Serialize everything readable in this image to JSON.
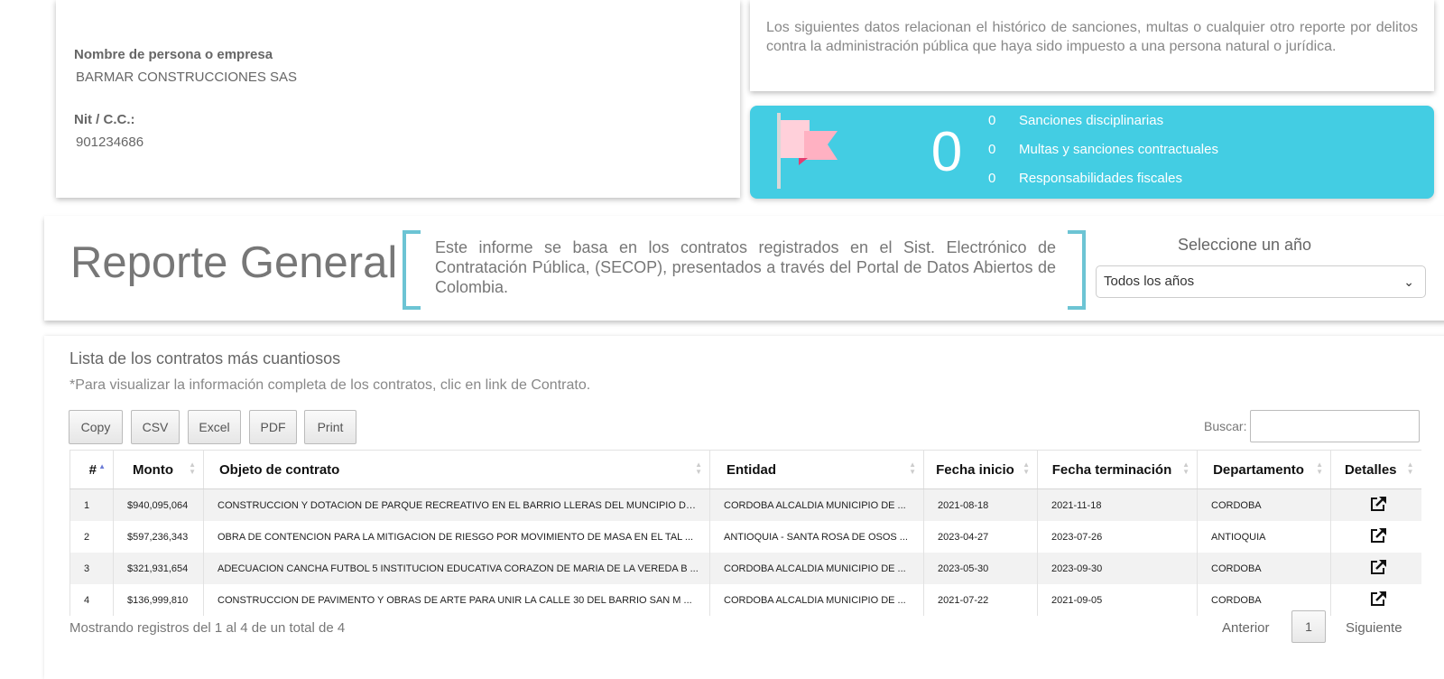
{
  "company": {
    "name_label": "Nombre de persona o empresa",
    "name_value": "BARMAR CONSTRUCCIONES SAS",
    "nit_label": "Nit / C.C.:",
    "nit_value": "901234686"
  },
  "sanctions_description": "Los siguientes datos relacionan el histórico de sanciones, multas o cualquier otro reporte por delitos contra la administración pública que haya sido impuesto a una persona natural o jurídica.",
  "sanctions": {
    "total": "0",
    "flag_icon": "flag-icon",
    "items": [
      {
        "count": "0",
        "label": "Sanciones disciplinarias"
      },
      {
        "count": "0",
        "label": "Multas y sanciones contractuales"
      },
      {
        "count": "0",
        "label": "Responsabilidades fiscales"
      }
    ],
    "background_color": "#43cde3"
  },
  "report": {
    "title": "Reporte General",
    "description": "Este informe se basa en los contratos registrados en el Sist. Electrónico de Contratación Pública, (SECOP), presentados a través del Portal de Datos Abiertos de Colombia.",
    "year_label": "Seleccione un año",
    "year_selected": "Todos los años",
    "accent_color": "#6cc4d4"
  },
  "list": {
    "title": "Lista de los contratos más cuantiosos",
    "note": "*Para visualizar la información completa de los contratos, clic en link de Contrato.",
    "buttons": [
      "Copy",
      "CSV",
      "Excel",
      "PDF",
      "Print"
    ],
    "search_label": "Buscar:",
    "search_value": "",
    "columns": [
      "#",
      "Monto",
      "Objeto de contrato",
      "Entidad",
      "Fecha inicio",
      "Fecha terminación",
      "Departamento",
      "Detalles"
    ],
    "rows": [
      {
        "num": "1",
        "monto": "$940,095,064",
        "objeto": "CONSTRUCCION Y DOTACION DE PARQUE RECREATIVO EN EL BARRIO LLERAS DEL MUNCIPIO DE ...",
        "entidad": "CORDOBA ALCALDIA MUNICIPIO DE ...",
        "inicio": "2021-08-18",
        "fin": "2021-11-18",
        "depto": "CORDOBA"
      },
      {
        "num": "2",
        "monto": "$597,236,343",
        "objeto": "OBRA DE CONTENCION PARA LA MITIGACION DE RIESGO POR MOVIMIENTO DE MASA EN EL TAL ...",
        "entidad": "ANTIOQUIA - SANTA ROSA DE OSOS ...",
        "inicio": "2023-04-27",
        "fin": "2023-07-26",
        "depto": "ANTIOQUIA"
      },
      {
        "num": "3",
        "monto": "$321,931,654",
        "objeto": "ADECUACION CANCHA FUTBOL 5 INSTITUCION EDUCATIVA CORAZON DE MARIA DE LA VEREDA B ...",
        "entidad": "CORDOBA ALCALDIA MUNICIPIO DE ...",
        "inicio": "2023-05-30",
        "fin": "2023-09-30",
        "depto": "CORDOBA"
      },
      {
        "num": "4",
        "monto": "$136,999,810",
        "objeto": "CONSTRUCCION DE PAVIMENTO Y OBRAS DE ARTE PARA UNIR LA CALLE 30 DEL BARRIO SAN M ...",
        "entidad": "CORDOBA ALCALDIA MUNICIPIO DE ...",
        "inicio": "2021-07-22",
        "fin": "2021-09-05",
        "depto": "CORDOBA"
      }
    ],
    "info": "Mostrando registros del 1 al 4 de un total de 4",
    "pagination": {
      "prev": "Anterior",
      "current": "1",
      "next": "Siguiente"
    }
  }
}
